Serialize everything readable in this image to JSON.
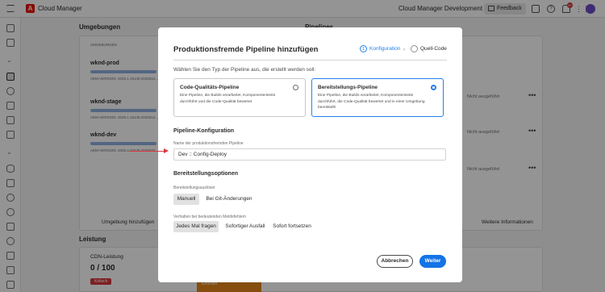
{
  "topbar": {
    "app_title": "Cloud Manager",
    "org_name": "Cloud Manager Development Team",
    "feedback_label": "Feedback",
    "notification_count": "9+"
  },
  "background": {
    "environments_heading": "Umgebungen",
    "pipelines_heading": "Pipelines",
    "column_label": "UMGEBUNGEN",
    "environments": [
      {
        "name": "wknd-prod",
        "version": "AEM-VERSION: 2025.1.19149.2025012..."
      },
      {
        "name": "wknd-stage",
        "version": "AEM-VERSION: 2025.1.19149.2025012..."
      },
      {
        "name": "wknd-dev",
        "version": "AEM-VERSION: 2025.4.20426.2025040..."
      }
    ],
    "pipeline_status": [
      "Nicht ausgeführt",
      "Nicht ausgeführt",
      "Nicht ausgeführt"
    ],
    "add_environment": "Umgebung hinzufügen",
    "more_info": "Weitere Informationen",
    "performance_heading": "Leistung",
    "cdn_label": "CDN-Leistung",
    "cdn_value": "0 / 100",
    "badge_text": "Kritisch",
    "status_pill": "Erfordert"
  },
  "modal": {
    "title": "Produktionsfremde Pipeline hinzufügen",
    "steps": [
      {
        "number": "1",
        "label": "Konfiguration"
      },
      {
        "number": "2",
        "label": "Quell-Code"
      }
    ],
    "prompt": "Wählen Sie den Typ der Pipeline aus, die erstellt werden soll:",
    "types": [
      {
        "title": "Code-Qualitäts-Pipeline",
        "description": "Eine Pipeline, die Builds verarbeitet, Komponententests durchführt und die Code-Qualität bewertet"
      },
      {
        "title": "Bereitstellungs-Pipeline",
        "description": "Eine Pipeline, die Builds verarbeitet, Komponententests durchführt, die Code-Qualität bewertet und in einer Umgebung bereitstellt"
      }
    ],
    "config_heading": "Pipeline-Konfiguration",
    "name_label": "Name der produktionsfremden Pipeline",
    "name_value": "Dev :: Config-Deploy",
    "deploy_heading": "Bereitstellungsoptionen",
    "trigger_label": "Bereitstellungsauslöser",
    "trigger_options": [
      "Manuell",
      "Bei Git-Änderungen"
    ],
    "trigger_selected": "Manuell",
    "failure_label": "Verhalten bei bedeutenden Metrikfehlern",
    "failure_options": [
      "Jedes Mal fragen",
      "Sofortiger Ausfall",
      "Sofort fortsetzen"
    ],
    "failure_selected": "Jedes Mal fragen",
    "cancel_label": "Abbrechen",
    "next_label": "Weiter"
  },
  "colors": {
    "accent": "#1473e6",
    "brand": "#eb1000",
    "annotation_arrow": "#d7373f"
  }
}
